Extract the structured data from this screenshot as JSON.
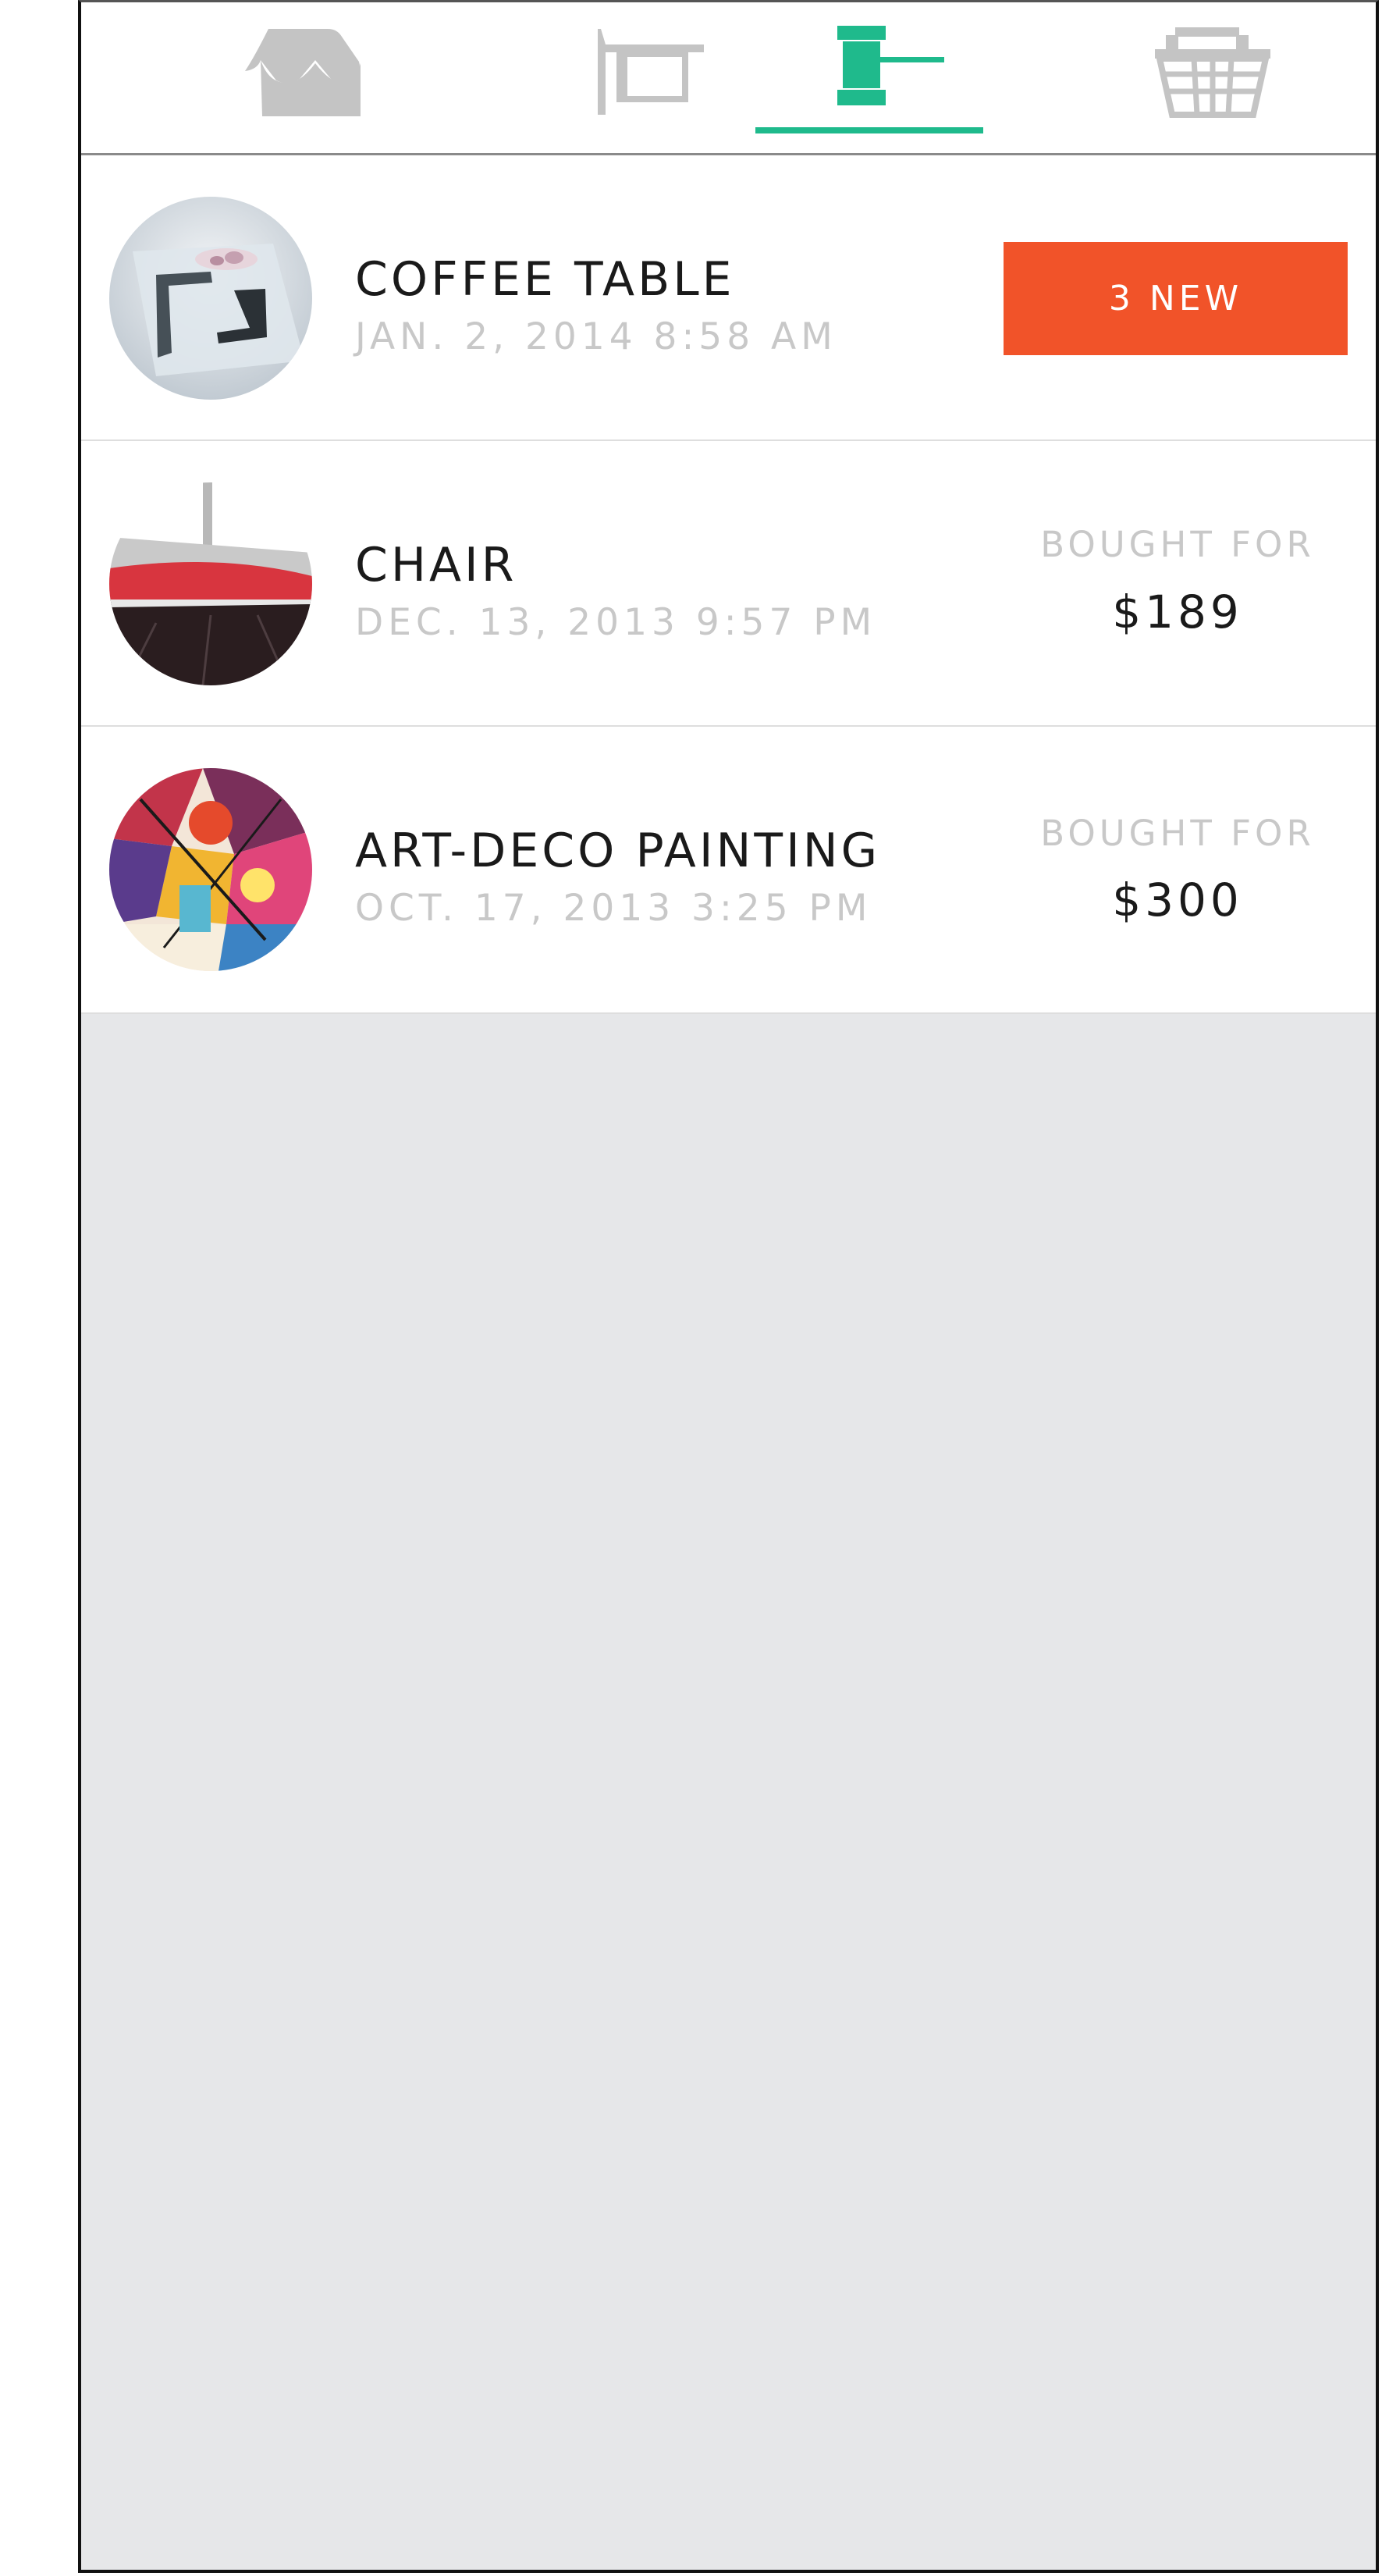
{
  "colors": {
    "accent": "#1fba8c",
    "new_badge": "#f15329",
    "inactive_icon": "#c4c4c4",
    "background": "#e6e7e9"
  },
  "tabs": [
    {
      "icon": "storefront-icon",
      "active": false
    },
    {
      "icon": "auction-sign-icon",
      "active": false
    },
    {
      "icon": "gavel-icon",
      "active": true
    },
    {
      "icon": "shopping-basket-icon",
      "active": false
    }
  ],
  "items": [
    {
      "title": "COFFEE TABLE",
      "date": "JAN. 2, 2014 8:58 AM",
      "badge": "3 NEW"
    },
    {
      "title": "CHAIR",
      "date": "DEC. 13, 2013 9:57 PM",
      "label": "BOUGHT FOR",
      "price": "$189"
    },
    {
      "title": "ART-DECO PAINTING",
      "date": "OCT. 17, 2013 3:25 PM",
      "label": "BOUGHT FOR",
      "price": "$300"
    }
  ]
}
